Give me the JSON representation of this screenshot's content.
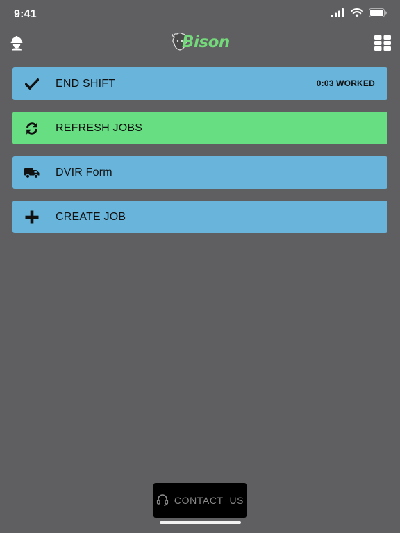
{
  "status_bar": {
    "time": "9:41",
    "icons": [
      "cellular-signal-icon",
      "wifi-icon",
      "battery-icon"
    ]
  },
  "header": {
    "logo_text": "Bison",
    "left_icon": "worker-helmet-icon",
    "right_icon": "grid-menu-icon"
  },
  "actions": [
    {
      "label": "END SHIFT",
      "meta": "0:03 WORKED",
      "icon": "checkmark-icon",
      "color": "#68b4db"
    },
    {
      "label": "REFRESH JOBS",
      "icon": "refresh-icon",
      "color": "#67de82"
    },
    {
      "label": "DVIR Form",
      "icon": "truck-icon",
      "color": "#68b4db"
    },
    {
      "label": "CREATE JOB",
      "icon": "plus-icon",
      "color": "#68b4db"
    }
  ],
  "contact": {
    "label": "CONTACT  US",
    "icon": "headset-icon"
  },
  "colors": {
    "background": "#5f5e60",
    "blue_button": "#68b4db",
    "green_button": "#67de82",
    "logo_green": "#74d97b",
    "contact_bg": "#000000"
  }
}
